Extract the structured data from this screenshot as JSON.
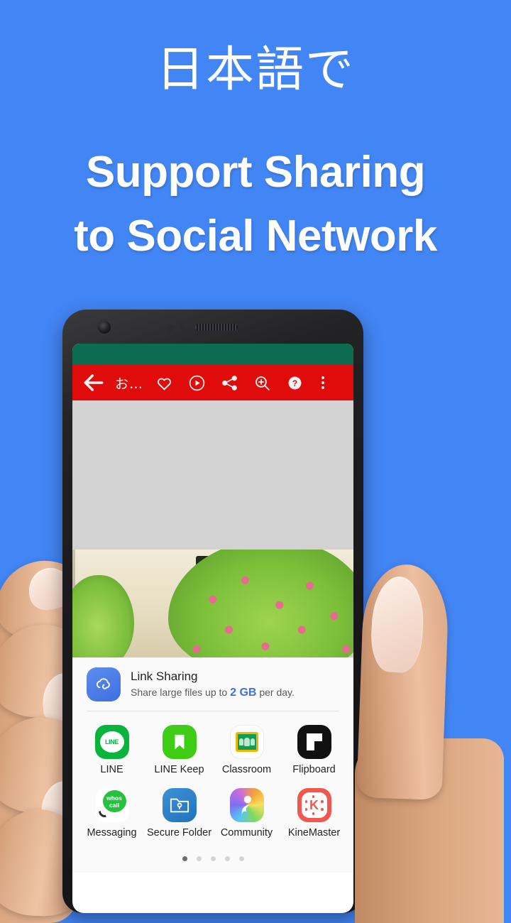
{
  "promo": {
    "japanese_line": "日本語で",
    "headline_line1": "Support Sharing",
    "headline_line2": "to Social Network",
    "background_color": "#4285f4",
    "text_color": "#ffffff"
  },
  "phone": {
    "appbar": {
      "background_color": "#e00b0b",
      "status_strip_color": "#0d6b52",
      "back_icon": "arrow-left-icon",
      "title": "お…",
      "actions": [
        {
          "name": "favorite-icon",
          "label": "Favorite"
        },
        {
          "name": "play-circle-icon",
          "label": "Play"
        },
        {
          "name": "share-icon",
          "label": "Share"
        },
        {
          "name": "zoom-in-icon",
          "label": "Zoom in"
        },
        {
          "name": "help-icon",
          "label": "Help"
        },
        {
          "name": "overflow-menu-icon",
          "label": "More options"
        }
      ]
    },
    "share_sheet": {
      "link_sharing": {
        "icon": "cloud-link-icon",
        "title": "Link Sharing",
        "subtitle_prefix": "Share large files up to ",
        "subtitle_highlight": "2 GB",
        "subtitle_suffix": " per day.",
        "highlight_color": "#3f6fe0"
      },
      "apps": [
        [
          {
            "icon": "line-icon",
            "label": "LINE"
          },
          {
            "icon": "line-keep-icon",
            "label": "LINE Keep"
          },
          {
            "icon": "classroom-icon",
            "label": "Classroom"
          },
          {
            "icon": "flipboard-icon",
            "label": "Flipboard"
          }
        ],
        [
          {
            "icon": "whoscall-messaging-icon",
            "label": "Messaging"
          },
          {
            "icon": "secure-folder-icon",
            "label": "Secure Folder"
          },
          {
            "icon": "community-icon",
            "label": "Community"
          },
          {
            "icon": "kinemaster-icon",
            "label": "KineMaster"
          }
        ]
      ],
      "whoscall_text_line1": "whos",
      "whoscall_text_line2": "call",
      "line_badge_text": "LINE",
      "kinemaster_letter": "K",
      "page_dots": {
        "total": 5,
        "active_index": 0
      }
    }
  }
}
